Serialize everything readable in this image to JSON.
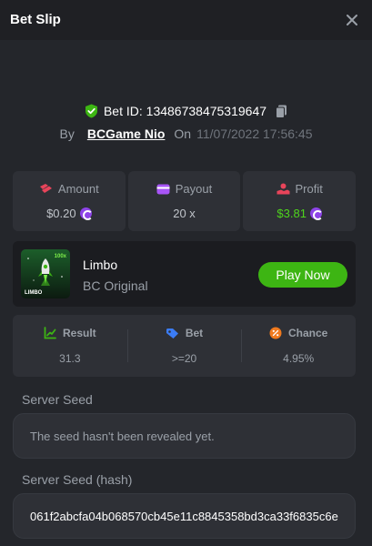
{
  "header": {
    "title": "Bet Slip"
  },
  "bet": {
    "id_label": "Bet ID: 13486738475319647",
    "by_label": "By",
    "user": "BCGame Nio",
    "on_label": "On",
    "date": "11/07/2022 17:56:45"
  },
  "stats": {
    "amount": {
      "label": "Amount",
      "value": "$0.20"
    },
    "payout": {
      "label": "Payout",
      "value": "20 x"
    },
    "profit": {
      "label": "Profit",
      "value": "$3.81"
    }
  },
  "game": {
    "name": "Limbo",
    "category": "BC Original",
    "thumb_text": "LIMBO",
    "thumb_multiplier": "100x",
    "play_label": "Play Now"
  },
  "result": {
    "result": {
      "label": "Result",
      "value": "31.3"
    },
    "bet": {
      "label": "Bet",
      "value": ">=20"
    },
    "chance": {
      "label": "Chance",
      "value": "4.95%"
    }
  },
  "server_seed": {
    "label": "Server Seed",
    "value": "The seed hasn't been revealed yet."
  },
  "server_seed_hash": {
    "label": "Server Seed (hash)",
    "value": "061f2abcfa04b068570cb45e11c8845358bd3ca33f6835c6e"
  },
  "colors": {
    "accent_green": "#3db513",
    "profit_green": "#4fd41d",
    "coin_purple": "#8e44e8",
    "background": "#24262b",
    "card": "#2e3036"
  }
}
